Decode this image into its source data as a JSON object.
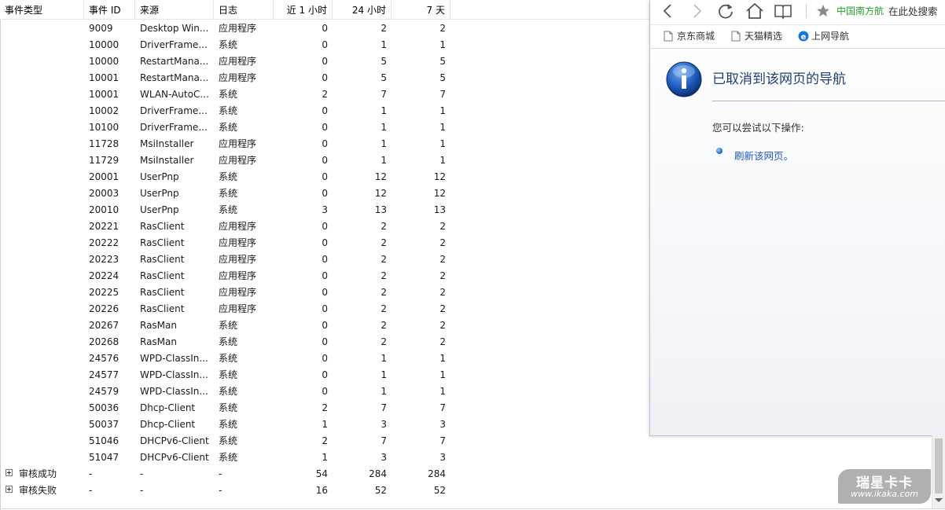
{
  "table": {
    "columns": [
      {
        "label": "事件类型"
      },
      {
        "label": "事件 ID"
      },
      {
        "label": "来源"
      },
      {
        "label": "日志"
      },
      {
        "label": "近 1 小时"
      },
      {
        "label": "24 小时"
      },
      {
        "label": "7 天"
      }
    ],
    "rows": [
      {
        "id": "9009",
        "source": "Desktop Win...",
        "log": "应用程序",
        "h1": "0",
        "h24": "2",
        "d7": "2"
      },
      {
        "id": "10000",
        "source": "DriverFrame...",
        "log": "系统",
        "h1": "0",
        "h24": "1",
        "d7": "1"
      },
      {
        "id": "10000",
        "source": "RestartMana...",
        "log": "应用程序",
        "h1": "0",
        "h24": "5",
        "d7": "5"
      },
      {
        "id": "10001",
        "source": "RestartMana...",
        "log": "应用程序",
        "h1": "0",
        "h24": "5",
        "d7": "5"
      },
      {
        "id": "10001",
        "source": "WLAN-AutoC...",
        "log": "系统",
        "h1": "2",
        "h24": "7",
        "d7": "7"
      },
      {
        "id": "10002",
        "source": "DriverFrame...",
        "log": "系统",
        "h1": "0",
        "h24": "1",
        "d7": "1"
      },
      {
        "id": "10100",
        "source": "DriverFrame...",
        "log": "系统",
        "h1": "0",
        "h24": "1",
        "d7": "1"
      },
      {
        "id": "11728",
        "source": "MsiInstaller",
        "log": "应用程序",
        "h1": "0",
        "h24": "1",
        "d7": "1"
      },
      {
        "id": "11729",
        "source": "MsiInstaller",
        "log": "应用程序",
        "h1": "0",
        "h24": "1",
        "d7": "1"
      },
      {
        "id": "20001",
        "source": "UserPnp",
        "log": "系统",
        "h1": "0",
        "h24": "12",
        "d7": "12"
      },
      {
        "id": "20003",
        "source": "UserPnp",
        "log": "系统",
        "h1": "0",
        "h24": "12",
        "d7": "12"
      },
      {
        "id": "20010",
        "source": "UserPnp",
        "log": "系统",
        "h1": "3",
        "h24": "13",
        "d7": "13"
      },
      {
        "id": "20221",
        "source": "RasClient",
        "log": "应用程序",
        "h1": "0",
        "h24": "2",
        "d7": "2"
      },
      {
        "id": "20222",
        "source": "RasClient",
        "log": "应用程序",
        "h1": "0",
        "h24": "2",
        "d7": "2"
      },
      {
        "id": "20223",
        "source": "RasClient",
        "log": "应用程序",
        "h1": "0",
        "h24": "2",
        "d7": "2"
      },
      {
        "id": "20224",
        "source": "RasClient",
        "log": "应用程序",
        "h1": "0",
        "h24": "2",
        "d7": "2"
      },
      {
        "id": "20225",
        "source": "RasClient",
        "log": "应用程序",
        "h1": "0",
        "h24": "2",
        "d7": "2"
      },
      {
        "id": "20226",
        "source": "RasClient",
        "log": "应用程序",
        "h1": "0",
        "h24": "2",
        "d7": "2"
      },
      {
        "id": "20267",
        "source": "RasMan",
        "log": "系统",
        "h1": "0",
        "h24": "2",
        "d7": "2"
      },
      {
        "id": "20268",
        "source": "RasMan",
        "log": "系统",
        "h1": "0",
        "h24": "2",
        "d7": "2"
      },
      {
        "id": "24576",
        "source": "WPD-ClassIn...",
        "log": "系统",
        "h1": "0",
        "h24": "1",
        "d7": "1"
      },
      {
        "id": "24577",
        "source": "WPD-ClassIn...",
        "log": "系统",
        "h1": "0",
        "h24": "1",
        "d7": "1"
      },
      {
        "id": "24579",
        "source": "WPD-ClassIn...",
        "log": "系统",
        "h1": "0",
        "h24": "1",
        "d7": "1"
      },
      {
        "id": "50036",
        "source": "Dhcp-Client",
        "log": "系统",
        "h1": "2",
        "h24": "7",
        "d7": "7"
      },
      {
        "id": "50037",
        "source": "Dhcp-Client",
        "log": "系统",
        "h1": "1",
        "h24": "3",
        "d7": "3"
      },
      {
        "id": "51046",
        "source": "DHCPv6-Client",
        "log": "系统",
        "h1": "2",
        "h24": "7",
        "d7": "7"
      },
      {
        "id": "51047",
        "source": "DHCPv6-Client",
        "log": "系统",
        "h1": "1",
        "h24": "3",
        "d7": "3"
      }
    ],
    "groups": [
      {
        "type": "审核成功",
        "id": "-",
        "source": "-",
        "log": "-",
        "h1": "54",
        "h24": "284",
        "d7": "284"
      },
      {
        "type": "审核失败",
        "id": "-",
        "source": "-",
        "log": "-",
        "h1": "16",
        "h24": "52",
        "d7": "52"
      }
    ]
  },
  "browser": {
    "toolbar": {
      "icons": [
        "back-icon",
        "forward-icon",
        "refresh-icon",
        "home-icon",
        "reading-icon",
        "star-icon"
      ],
      "site_name": "中国南方航",
      "search_text": "在此处搜索"
    },
    "favorites": [
      {
        "label": "京东商城",
        "icon": "page-icon"
      },
      {
        "label": "天猫精选",
        "icon": "page-icon"
      },
      {
        "label": "上网导航",
        "icon": "ie-icon"
      }
    ],
    "error": {
      "title": "已取消到该网页的导航",
      "hint": "您可以尝试以下操作:",
      "action": "刷新该网页。"
    }
  },
  "watermark": {
    "title": "瑞星卡卡",
    "url": "www.ikaka.com"
  },
  "colors": {
    "site_name": "#2aa52a",
    "error_title": "#1e3f73",
    "link": "#1c57c4",
    "info_icon": "#1f5fbf"
  }
}
